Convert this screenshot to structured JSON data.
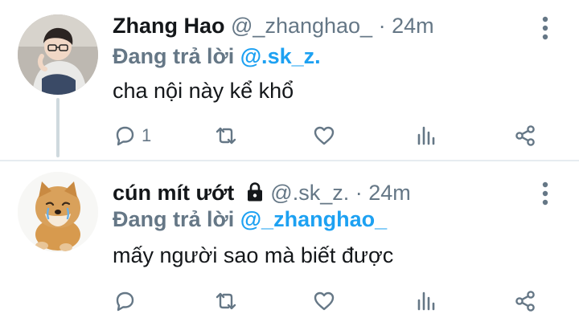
{
  "tweets": [
    {
      "display_name": "Zhang Hao",
      "handle": "@_zhanghao_",
      "separator": "·",
      "time": "24m",
      "replying_prefix": "Đang trả lời",
      "replying_to": "@.sk_z.",
      "text": "cha nội này kể khổ",
      "reply_count": "1",
      "avatar": "boy-with-glasses-avatar"
    },
    {
      "display_name": "cún mít ướt",
      "protected_icon": "lock-icon",
      "handle": "@.sk_z.",
      "separator": "·",
      "time": "24m",
      "replying_prefix": "Đang trả lời",
      "replying_to": "@_zhanghao_",
      "text": "mấy người sao mà biết được",
      "reply_count": "",
      "avatar": "shiba-dog-avatar"
    }
  ],
  "colors": {
    "link": "#1da1f2",
    "secondary_text": "#657786",
    "primary_text": "#14171a",
    "divider": "#e6ecf0"
  }
}
